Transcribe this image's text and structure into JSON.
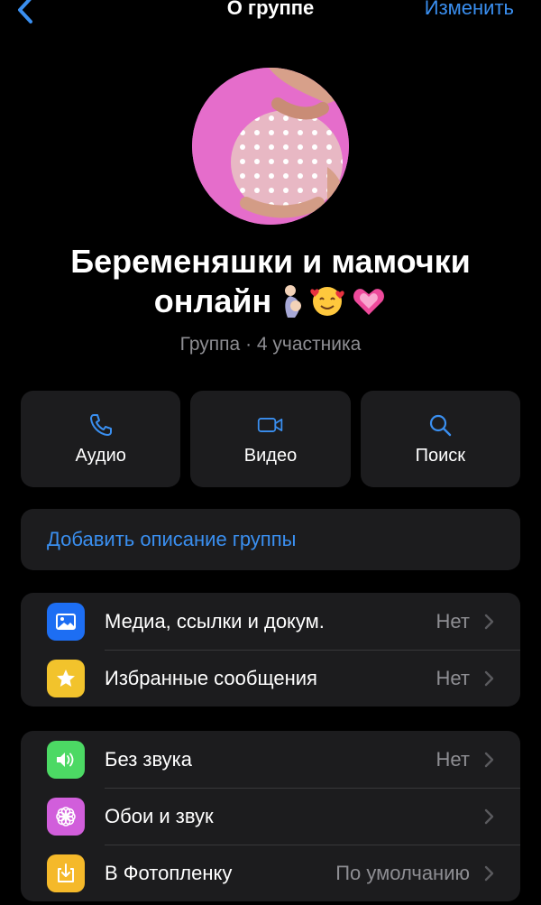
{
  "navbar": {
    "title": "О группе",
    "edit_label": "Изменить"
  },
  "group": {
    "title_line1": "Беременяшки и мамочки",
    "title_line2": "онлайн",
    "subtitle": "Группа · 4 участника"
  },
  "actions": [
    {
      "label": "Аудио",
      "icon": "phone-icon"
    },
    {
      "label": "Видео",
      "icon": "video-camera-icon"
    },
    {
      "label": "Поиск",
      "icon": "search-icon"
    }
  ],
  "description": {
    "link": "Добавить описание группы"
  },
  "list1": [
    {
      "label": "Медиа, ссылки и докум.",
      "value": "Нет",
      "icon": "photo-icon",
      "color": "#1d6ef3"
    },
    {
      "label": "Избранные сообщения",
      "value": "Нет",
      "icon": "star-icon",
      "color": "#f2c32c"
    }
  ],
  "list2": [
    {
      "label": "Без звука",
      "value": "Нет",
      "icon": "speaker-icon",
      "color": "#4cd964"
    },
    {
      "label": "Обои и звук",
      "value": "",
      "icon": "flower-icon",
      "color": "#d15edb"
    },
    {
      "label": "В Фотопленку",
      "value": "По умолчанию",
      "icon": "download-icon",
      "color": "#f5b92a"
    }
  ],
  "colors": {
    "accent": "#3a8ff0",
    "background": "#000000",
    "card": "#1c1c1e",
    "secondary_text": "#8e8e93"
  }
}
